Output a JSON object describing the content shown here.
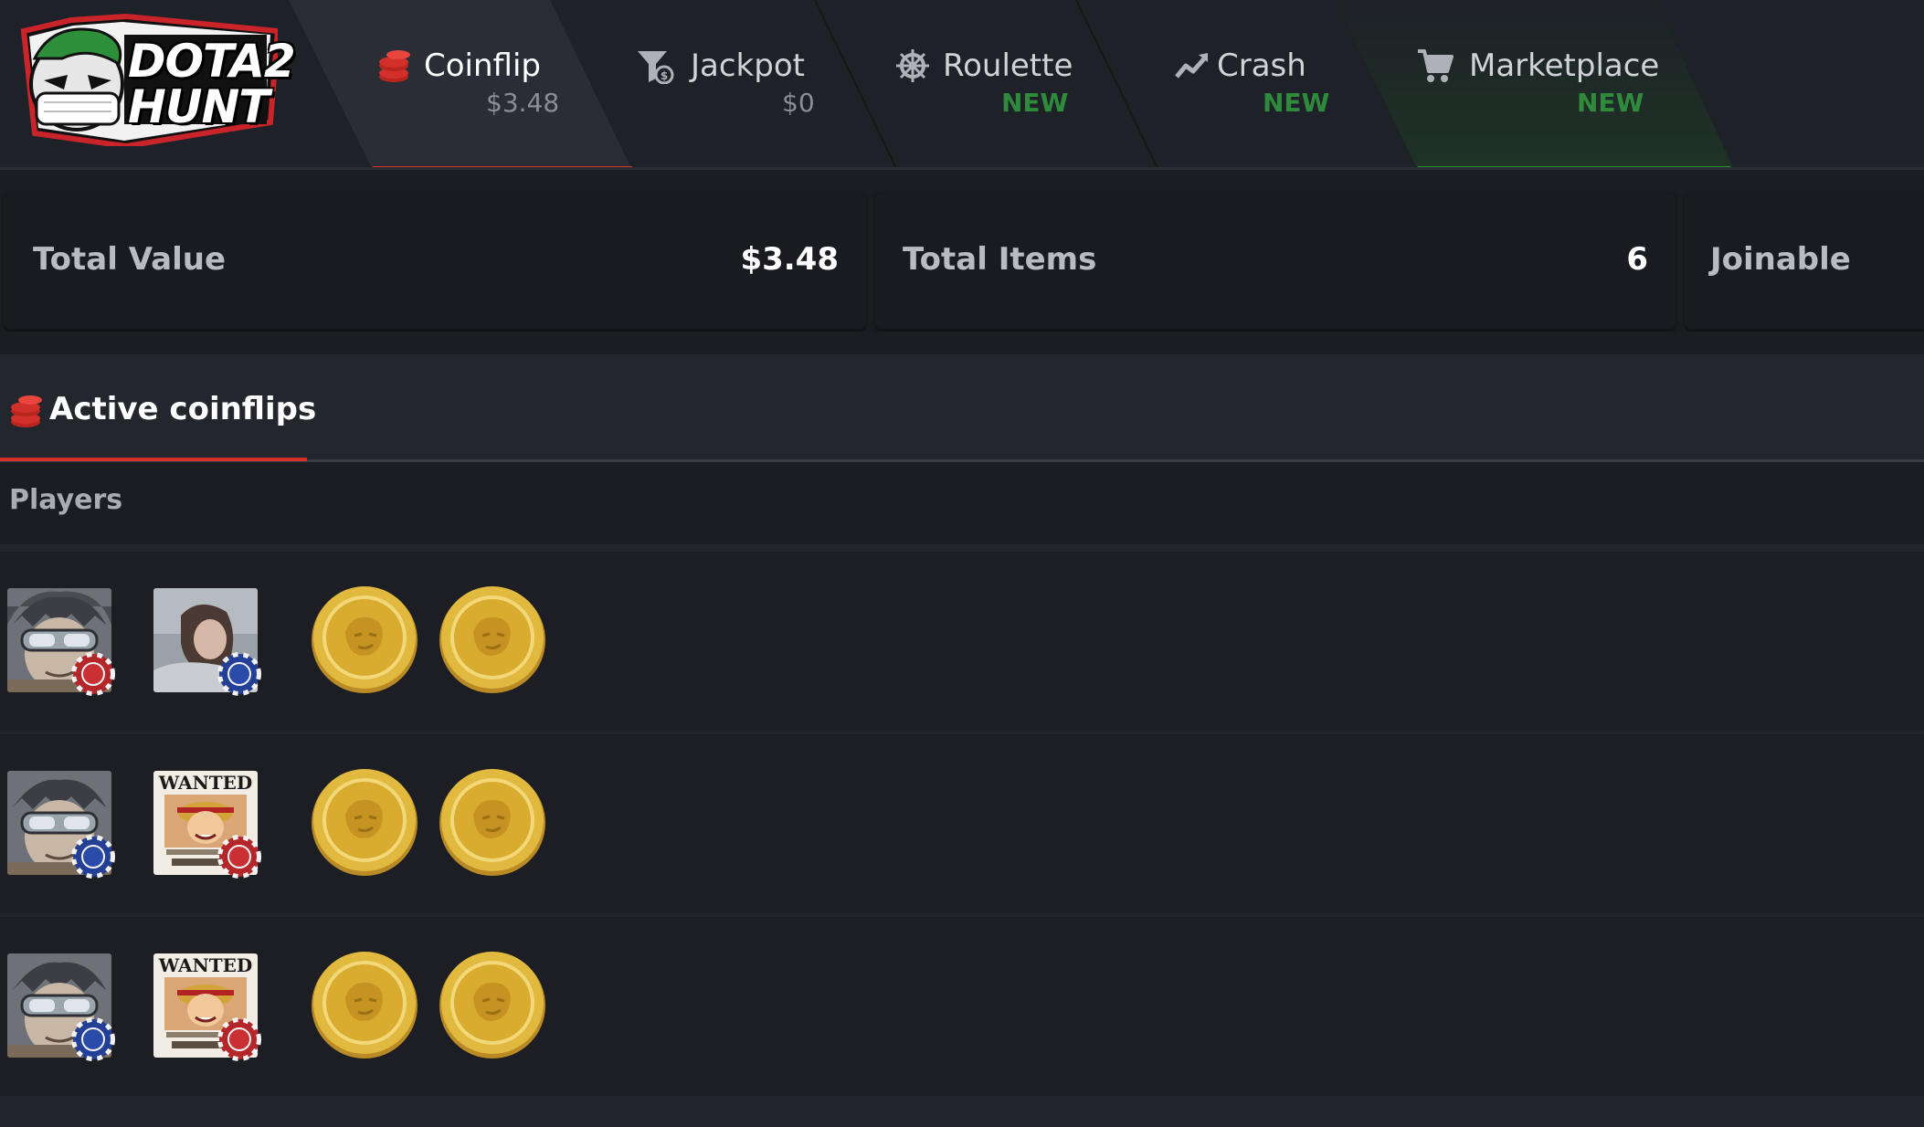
{
  "brand": {
    "logo_line1": "DOTA2",
    "logo_line2": "HUNT"
  },
  "nav": {
    "tabs": [
      {
        "label": "Coinflip",
        "sub": "$3.48",
        "icon": "coins-stack-icon",
        "active": true
      },
      {
        "label": "Jackpot",
        "sub": "$0",
        "icon": "funnel-dollar-icon"
      },
      {
        "label": "Roulette",
        "sub": "NEW",
        "icon": "ship-wheel-icon"
      },
      {
        "label": "Crash",
        "sub": "NEW",
        "icon": "trend-up-icon"
      },
      {
        "label": "Marketplace",
        "sub": "NEW",
        "icon": "cart-icon"
      }
    ]
  },
  "stats": {
    "total_value_label": "Total Value",
    "total_value": "$3.48",
    "total_items_label": "Total Items",
    "total_items": "6",
    "joinable_label": "Joinable"
  },
  "coinflips": {
    "title": "Active coinflips",
    "players_label": "Players",
    "rows": [
      {
        "player1": "avatar-goggles-boy",
        "player1_chip": "red",
        "player2": "avatar-photo-girl",
        "player2_chip": "blue",
        "coins": 2
      },
      {
        "player1": "avatar-goggles-boy",
        "player1_chip": "blue",
        "player2": "avatar-wanted-poster",
        "player2_chip": "red",
        "coins": 2
      },
      {
        "player1": "avatar-goggles-boy",
        "player1_chip": "blue",
        "player2": "avatar-wanted-poster",
        "player2_chip": "red",
        "coins": 2
      }
    ]
  },
  "colors": {
    "accent_red": "#d3302b",
    "accent_green": "#2f8a3b",
    "background": "#1b1d22"
  }
}
